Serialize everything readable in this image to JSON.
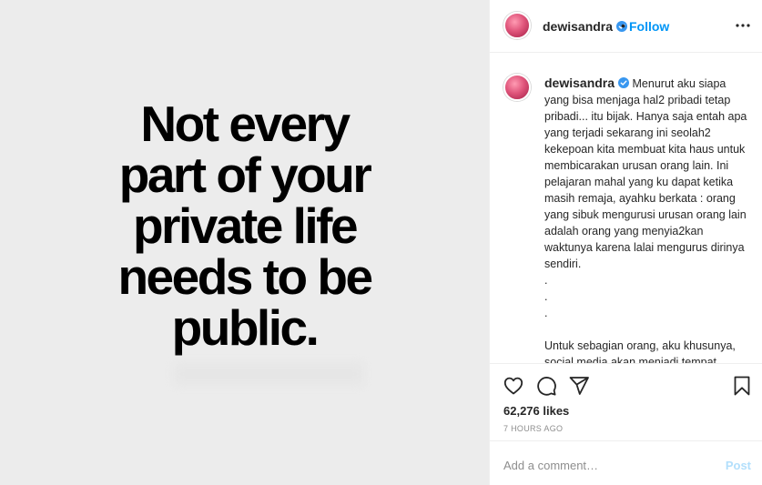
{
  "post": {
    "quote_lines": [
      "Not every",
      "part of your",
      "private life",
      "needs to be",
      "public."
    ]
  },
  "header": {
    "username": "dewisandra",
    "separator": "•",
    "follow_label": "Follow"
  },
  "caption": {
    "username": "dewisandra",
    "lines": [
      "Menurut aku siapa yang bisa menjaga hal2 pribadi tetap pribadi... itu bijak. Hanya saja entah apa yang terjadi sekarang ini seolah2 kekepoan kita membuat kita haus untuk membicarakan urusan orang lain. Ini pelajaran mahal yang ku dapat ketika masih remaja, ayahku berkata : orang yang sibuk mengurusi urusan orang lain adalah orang yang menyia2kan waktunya karena lalai mengurus dirinya sendiri.",
      ".",
      ".",
      ".",
      "Untuk sebagian orang, aku khusunya, social media akan menjadi tempat terakhir ku untuk share hal yang “private” karena cara orang untuk mengungkapkan hati dan rasa tidak"
    ]
  },
  "actions": {
    "icons": [
      "heart-icon",
      "comment-icon",
      "share-icon",
      "bookmark-icon"
    ],
    "likes": "62,276 likes",
    "time": "7 HOURS AGO"
  },
  "comment_box": {
    "placeholder": "Add a comment…",
    "post_label": "Post"
  },
  "colors": {
    "accent": "#0095f6",
    "post_disabled": "#b2dffc",
    "media_bg": "#ececec"
  }
}
